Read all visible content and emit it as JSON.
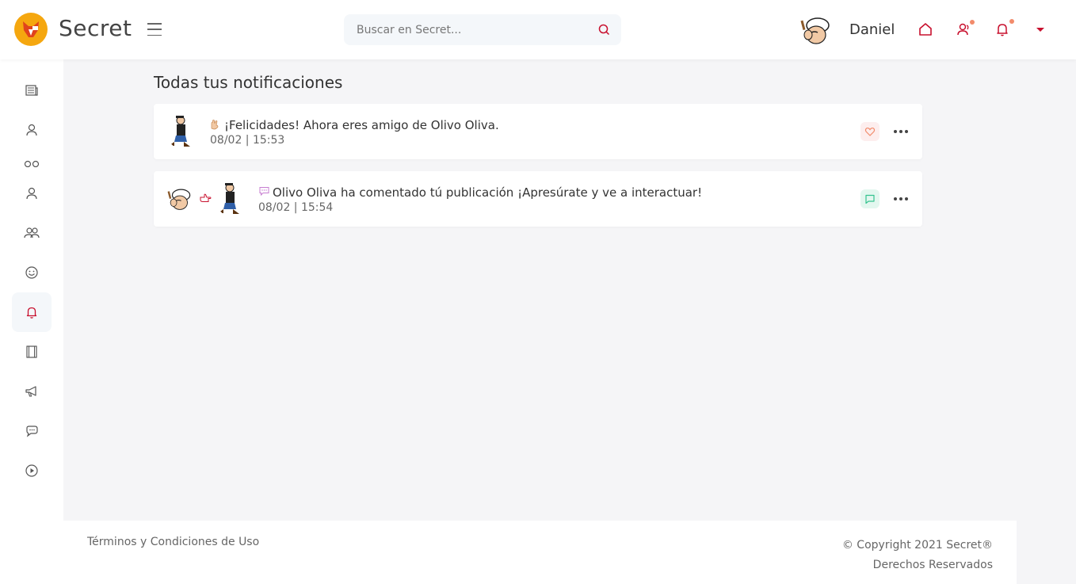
{
  "app": {
    "name": "Secret"
  },
  "search": {
    "placeholder": "Buscar en Secret..."
  },
  "user": {
    "name": "Daniel"
  },
  "colors": {
    "accent": "#c8102e",
    "logo": "#f5a70f",
    "like": "#f28b6b",
    "comment": "#34c38f"
  },
  "sidebar": {
    "items": [
      {
        "icon": "newspaper-icon"
      },
      {
        "icon": "user-icon"
      },
      {
        "icon": "users-icon"
      },
      {
        "icon": "user-icon"
      },
      {
        "icon": "users-group-icon"
      },
      {
        "icon": "smile-icon"
      },
      {
        "icon": "bell-icon",
        "active": true
      },
      {
        "icon": "film-icon"
      },
      {
        "icon": "megaphone-icon"
      },
      {
        "icon": "chat-icon"
      },
      {
        "icon": "play-icon"
      }
    ]
  },
  "main": {
    "title": "Todas tus notificaciones",
    "notifications": [
      {
        "icon": "wave-icon",
        "message": "¡Felicidades! Ahora eres amigo de Olivo Oliva.",
        "time": "08/02 | 15:53",
        "action": "heart-icon"
      },
      {
        "icon": "comment-icon",
        "message": "Olivo Oliva ha comentado tú publicación ¡Apresúrate y ve a interactuar!",
        "time": "08/02 | 15:54",
        "action": "message-square-icon"
      }
    ]
  },
  "footer": {
    "terms": "Términos y Condiciones de Uso",
    "copyright": "© Copyright 2021 Secret®",
    "rights": "Derechos Reservados"
  }
}
